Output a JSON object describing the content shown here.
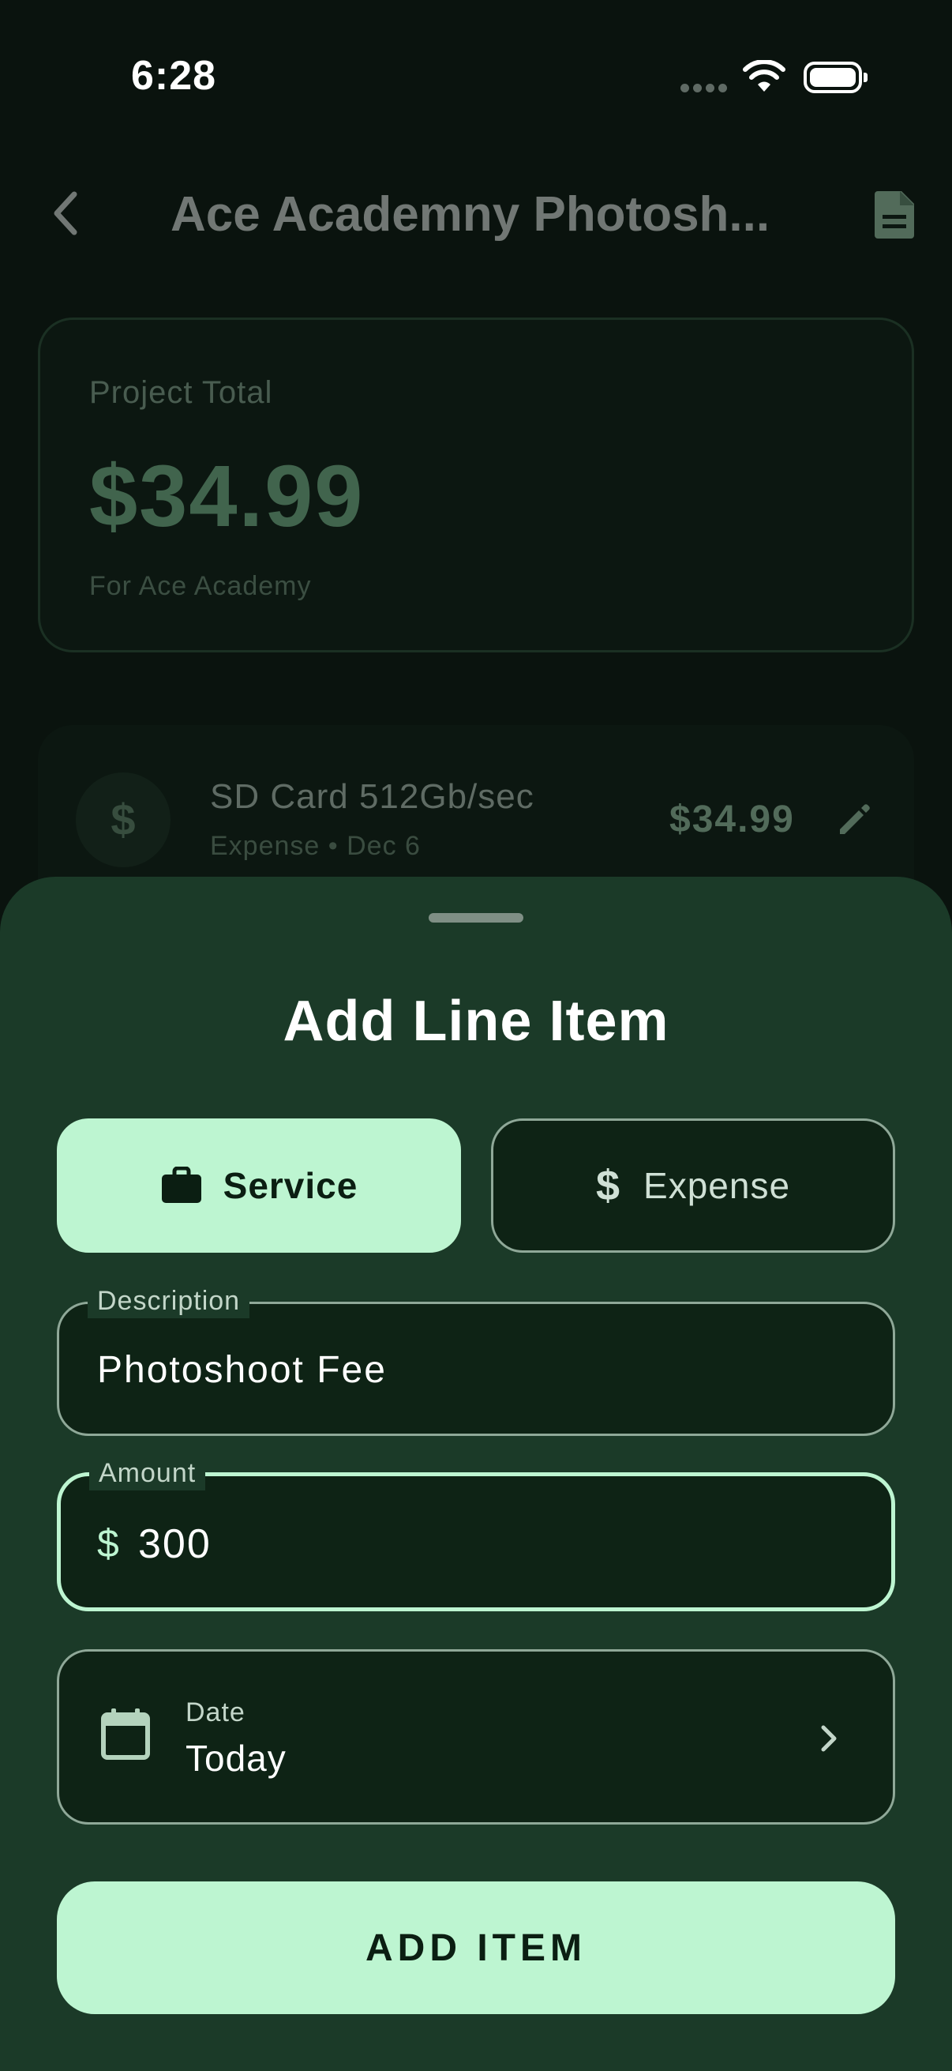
{
  "status_bar": {
    "time": "6:28"
  },
  "header": {
    "title": "Ace Academny Photosh...",
    "back_icon": "chevron-left-icon",
    "document_icon": "document-icon"
  },
  "project_summary": {
    "label": "Project Total",
    "amount": "$34.99",
    "client_line": "For Ace Academy"
  },
  "line_items": [
    {
      "icon_glyph": "$",
      "name": "SD Card 512Gb/sec",
      "meta": "Expense • Dec 6",
      "price": "$34.99"
    }
  ],
  "sheet": {
    "title": "Add Line Item",
    "type_options": {
      "service": "Service",
      "expense": "Expense",
      "selected": "service"
    },
    "description": {
      "label": "Description",
      "value": "Photoshoot Fee"
    },
    "amount": {
      "label": "Amount",
      "prefix": "$",
      "value": "300"
    },
    "date": {
      "label": "Date",
      "value": "Today"
    },
    "submit_label": "ADD ITEM"
  },
  "colors": {
    "sheet_background": "#1b3a28",
    "accent": "#bdf5d1",
    "field_background": "#0e2315",
    "page_background": "#0a130e"
  }
}
